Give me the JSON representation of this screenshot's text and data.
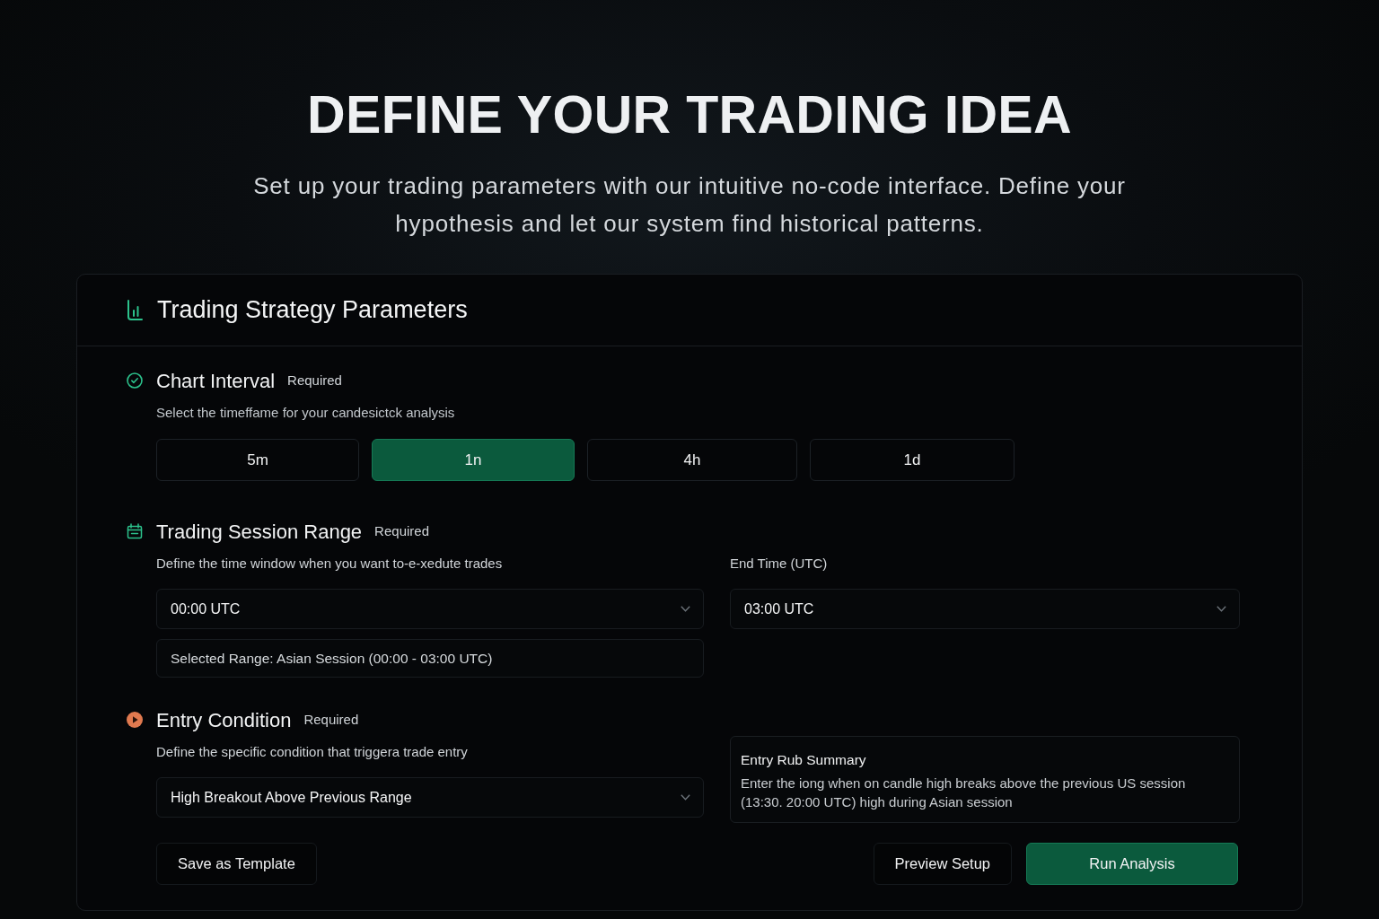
{
  "hero": {
    "title": "DEFINE YOUR TRADING IDEA",
    "subtitle": "Set up your trading parameters with our intuitive no-code interface. Define your hypothesis and let our system find historical patterns."
  },
  "panel": {
    "title": "Trading Strategy Parameters"
  },
  "chart_interval": {
    "title": "Chart Interval",
    "badge": "Required",
    "description": "Select the timeffame for your candesictck analysis",
    "options": [
      {
        "label": "5m",
        "selected": false
      },
      {
        "label": "1n",
        "selected": true
      },
      {
        "label": "4h",
        "selected": false
      },
      {
        "label": "1d",
        "selected": false
      }
    ]
  },
  "session_range": {
    "title": "Trading Session Range",
    "badge": "Required",
    "description": "Define the time window when you want to-e-xedute trades",
    "start_select": {
      "value": "00:00 UTC"
    },
    "range_note": "Selected Range: Asian Session (00:00 - 03:00 UTC)",
    "end_label": "End Time (UTC)",
    "end_select": {
      "value": "03:00 UTC"
    }
  },
  "entry_condition": {
    "title": "Entry Condition",
    "badge": "Required",
    "description": "Define the specific condition that triggera trade entry",
    "select": {
      "value": "High Breakout Above Previous Range"
    },
    "summary": {
      "title": "Entry Rub Summary",
      "text": "Enter the iong when on candle high breaks above the previous US session (13:30. 20:00 UTC) high during Asian session"
    }
  },
  "footer": {
    "start": [
      {
        "label": "Save as Template",
        "kind": "secondary"
      }
    ],
    "end": [
      {
        "label": "Preview Setup",
        "kind": "secondary"
      },
      {
        "label": "Run Analysis",
        "kind": "primary"
      }
    ]
  }
}
